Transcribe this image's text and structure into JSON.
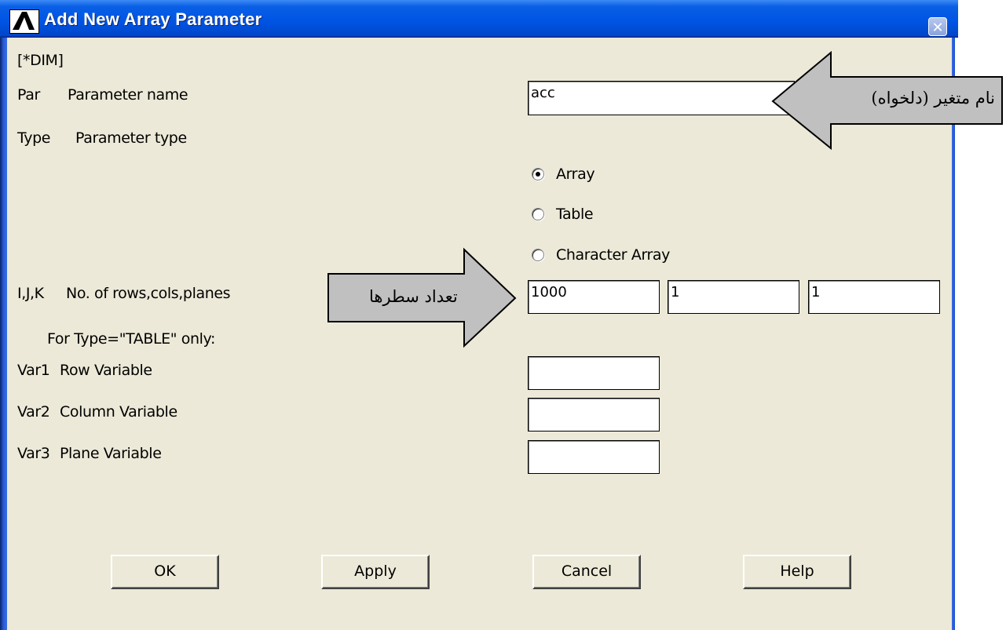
{
  "window": {
    "title": "Add New Array Parameter",
    "logo_icon": "ansys-logo-icon",
    "close_icon": "close-icon"
  },
  "command": "[*DIM]",
  "fields": {
    "par": {
      "code": "Par",
      "label": "Parameter name",
      "value": "acc"
    },
    "type": {
      "code": "Type",
      "label": "Parameter type"
    },
    "ijk": {
      "code": "I,J,K",
      "label": "No. of rows,cols,planes",
      "i": "1000",
      "j": "1",
      "k": "1"
    },
    "table_note": "For Type=\"TABLE\" only:",
    "var1": {
      "code": "Var1",
      "label": "Row Variable",
      "value": ""
    },
    "var2": {
      "code": "Var2",
      "label": "Column Variable",
      "value": ""
    },
    "var3": {
      "code": "Var3",
      "label": "Plane Variable",
      "value": ""
    }
  },
  "type_options": [
    {
      "label": "Array",
      "selected": true
    },
    {
      "label": "Table",
      "selected": false
    },
    {
      "label": "Character Array",
      "selected": false
    }
  ],
  "buttons": {
    "ok": "OK",
    "apply": "Apply",
    "cancel": "Cancel",
    "help": "Help"
  },
  "annotations": {
    "name_arrow": "نام متغیر (دلخواه)",
    "rows_arrow": "تعداد سطرها"
  }
}
